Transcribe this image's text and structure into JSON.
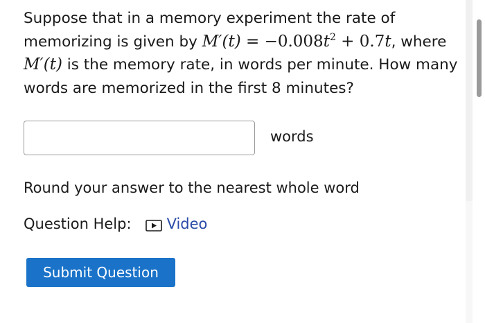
{
  "question": {
    "text_before": "Suppose that in a memory experiment the rate of memorizing is given by ",
    "equation": "M′(t) = −0.008t² + 0.7t",
    "eq_lhs": "M′(t)",
    "eq_rhs_a": "−0.008",
    "eq_rhs_t1": "t",
    "eq_rhs_exp": "2",
    "eq_rhs_b": " + 0.7",
    "eq_rhs_t2": "t",
    "text_middle": ", where ",
    "rate_symbol": "M′(t)",
    "text_after": " is the memory rate, in words per minute. How many words are memorized in the first 8 minutes?"
  },
  "answer": {
    "value": "",
    "placeholder": "",
    "unit_label": "words"
  },
  "instruction": "Round your answer to the nearest whole word",
  "help": {
    "label": "Question Help:",
    "video_label": "Video"
  },
  "submit_label": "Submit Question",
  "colors": {
    "link": "#2a4ba8",
    "submit_bg": "#1a73c9",
    "text": "#1a1a1a"
  },
  "icons": {
    "video": "play-icon"
  }
}
